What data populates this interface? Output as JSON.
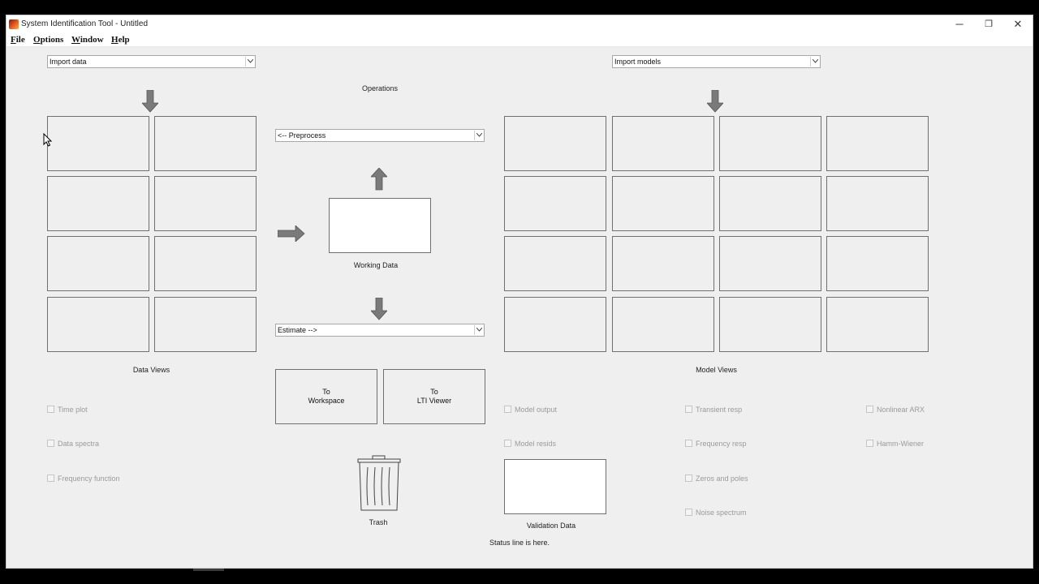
{
  "window": {
    "title": "System Identification Tool - Untitled",
    "minimize_glyph": "─",
    "restore_glyph": "❐",
    "close_glyph": "✕"
  },
  "menu": [
    "File",
    "Options",
    "Window",
    "Help"
  ],
  "data_side": {
    "import_combo": "Import data",
    "views_label": "Data Views",
    "checkboxes": [
      "Time plot",
      "Data spectra",
      "Frequency function"
    ]
  },
  "operations": {
    "title": "Operations",
    "preprocess_combo": "<-- Preprocess",
    "working_data_label": "Working Data",
    "estimate_combo": "Estimate -->",
    "to_workspace": [
      "To",
      "Workspace"
    ],
    "to_lti_viewer": [
      "To",
      "LTI Viewer"
    ],
    "trash_label": "Trash"
  },
  "model_side": {
    "import_combo": "Import models",
    "views_label": "Model Views",
    "checkboxes_col1": [
      "Model output",
      "Model resids"
    ],
    "checkboxes_col2": [
      "Transient resp",
      "Frequency resp",
      "Zeros and poles",
      "Noise spectrum"
    ],
    "checkboxes_col3": [
      "Nonlinear ARX",
      "Hamm-Wiener"
    ],
    "validation_label": "Validation Data"
  },
  "status": "Status line is here.",
  "icons": {
    "app": "matlab-icon",
    "arrow_down": "down-arrow-icon",
    "arrow_up": "up-arrow-icon",
    "arrow_right": "right-arrow-icon",
    "trash": "trash-icon",
    "dropdown": "chevron-down-icon"
  },
  "colors": {
    "background": "#efefef",
    "arrow": "#7a7a7a",
    "border": "#707070"
  }
}
